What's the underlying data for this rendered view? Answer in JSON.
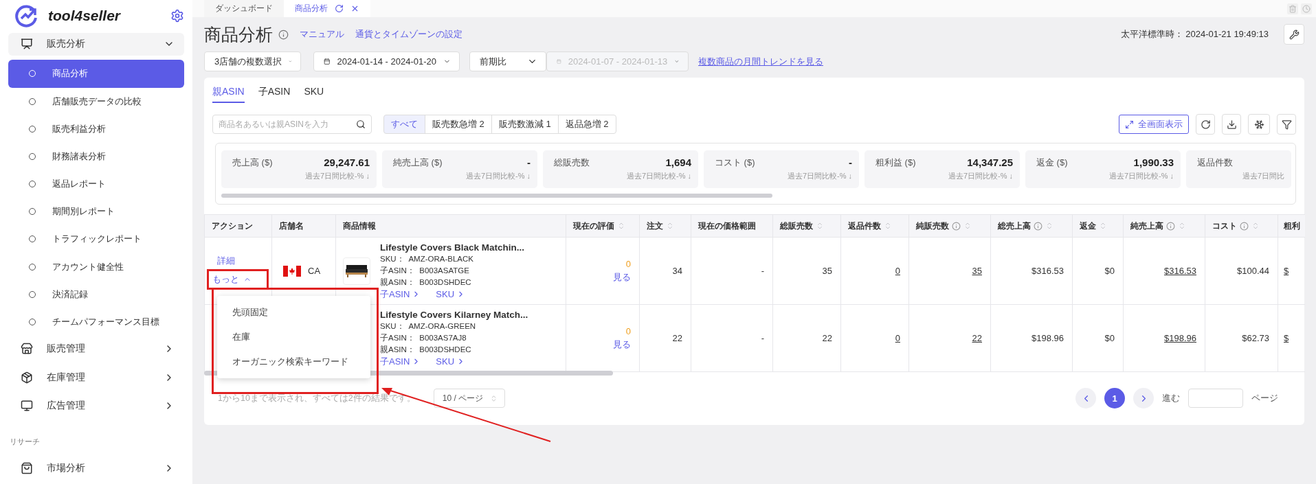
{
  "sidebar": {
    "brand": "tool4seller",
    "sections": [
      {
        "label": "販売分析",
        "expanded": true,
        "children": [
          {
            "label": "商品分析",
            "selected": true
          },
          {
            "label": "店舗販売データの比較",
            "selected": false
          },
          {
            "label": "販売利益分析",
            "selected": false
          },
          {
            "label": "財務諸表分析",
            "selected": false
          },
          {
            "label": "返品レポート",
            "selected": false
          },
          {
            "label": "期間別レポート",
            "selected": false
          },
          {
            "label": "トラフィックレポート",
            "selected": false
          },
          {
            "label": "アカウント健全性",
            "selected": false
          },
          {
            "label": "決済記録",
            "selected": false
          },
          {
            "label": "チームパフォーマンス目標",
            "selected": false
          }
        ]
      },
      {
        "label": "販売管理",
        "expanded": false
      },
      {
        "label": "在庫管理",
        "expanded": false
      },
      {
        "label": "広告管理",
        "expanded": false
      }
    ],
    "heading": "リサーチ",
    "research": [
      {
        "label": "市場分析",
        "expanded": false
      }
    ]
  },
  "page_tabs": [
    {
      "label": "ダッシュボード",
      "selected": false
    },
    {
      "label": "商品分析",
      "selected": true
    }
  ],
  "header": {
    "title": "商品分析",
    "links": [
      "マニュアル",
      "通貨とタイムゾーンの設定"
    ],
    "clock": "太平洋標準時： 2024-01-21 19:49:13"
  },
  "filters": {
    "store_select": "3店舗の複数選択",
    "date_range": "2024-01-14 - 2024-01-20",
    "compare_select": "前期比",
    "compare_range": {
      "value": "2024-01-07 - 2024-01-13",
      "disabled": true
    },
    "trend_link": "複数商品の月間トレンドを見る"
  },
  "view_tabs": [
    {
      "label": "親ASIN",
      "selected": true
    },
    {
      "label": "子ASIN",
      "selected": false
    },
    {
      "label": "SKU",
      "selected": false
    }
  ],
  "search": {
    "placeholder": "商品名あるいは親ASINを入力"
  },
  "segments": [
    {
      "label": "すべて",
      "selected": true
    },
    {
      "label": "販売数急増 2",
      "selected": false
    },
    {
      "label": "販売数激減 1",
      "selected": false
    },
    {
      "label": "返品急増 2",
      "selected": false
    }
  ],
  "fullscreen_button": "全画面表示",
  "metrics": [
    {
      "label": "売上高 ($)",
      "value": "29,247.61",
      "change": "過去7日間比較-% ↓"
    },
    {
      "label": "純売上高 ($)",
      "value": "-",
      "change": "過去7日間比較-% ↓"
    },
    {
      "label": "総販売数",
      "value": "1,694",
      "change": "過去7日間比較-% ↓"
    },
    {
      "label": "コスト ($)",
      "value": "-",
      "change": "過去7日間比較-% ↓"
    },
    {
      "label": "粗利益 ($)",
      "value": "14,347.25",
      "change": "過去7日間比較-% ↓"
    },
    {
      "label": "返金 ($)",
      "value": "1,990.33",
      "change": "過去7日間比較-% ↓"
    },
    {
      "label": "返品件数",
      "change": "過去7日間比"
    }
  ],
  "table": {
    "columns": [
      {
        "label": "アクション",
        "sortable": false,
        "info": false
      },
      {
        "label": "店舗名",
        "sortable": false,
        "info": false
      },
      {
        "label": "商品情報",
        "sortable": false,
        "info": false
      },
      {
        "label": "現在の評価",
        "sortable": true,
        "info": false
      },
      {
        "label": "注文",
        "sortable": true,
        "info": false
      },
      {
        "label": "現在の価格範囲",
        "sortable": false,
        "info": false
      },
      {
        "label": "総販売数",
        "sortable": true,
        "info": false
      },
      {
        "label": "返品件数",
        "sortable": true,
        "info": false
      },
      {
        "label": "純販売数",
        "sortable": true,
        "info": true
      },
      {
        "label": "総売上高",
        "sortable": true,
        "info": true
      },
      {
        "label": "返金",
        "sortable": true,
        "info": false
      },
      {
        "label": "純売上高",
        "sortable": true,
        "info": true
      },
      {
        "label": "コスト",
        "sortable": true,
        "info": true
      },
      {
        "label": "粗利"
      }
    ],
    "rows": [
      {
        "detail": "詳細",
        "more": "もっと",
        "country": "CA",
        "product": {
          "kind": "picture",
          "title": "Lifestyle Covers Black Matchin...",
          "meta": [
            "SKU：  AMZ-ORA-BLACK",
            "子ASIN：  B003ASATGE",
            "親ASIN：  B003DSHDEC"
          ],
          "links": [
            "子ASIN",
            "SKU"
          ]
        },
        "rating": {
          "value": "0",
          "link": "見る"
        },
        "values": [
          {
            "text": "34",
            "underline": false
          },
          {
            "text": "-",
            "underline": false
          },
          {
            "text": "35",
            "underline": false
          },
          {
            "text": "0",
            "underline": true
          },
          {
            "text": "35",
            "underline": true
          },
          {
            "text": "$316.53",
            "underline": false
          },
          {
            "text": "$0",
            "underline": false
          },
          {
            "text": "$316.53",
            "underline": true
          },
          {
            "text": "$100.44",
            "underline": false
          },
          {
            "text": "$",
            "underline": true
          }
        ]
      },
      {
        "product": {
          "title": "Lifestyle Covers Kilarney Match...",
          "meta": [
            "SKU：  AMZ-ORA-GREEN",
            "子ASIN：  B003AS7AJ8",
            "親ASIN：  B003DSHDEC"
          ],
          "links": [
            "子ASIN",
            "SKU"
          ]
        },
        "rating": {
          "value": "0",
          "link": "見る"
        },
        "values": [
          {
            "text": "22",
            "underline": false
          },
          {
            "text": "-",
            "underline": false
          },
          {
            "text": "22",
            "underline": false
          },
          {
            "text": "0",
            "underline": true
          },
          {
            "text": "22",
            "underline": true
          },
          {
            "text": "$198.96",
            "underline": false
          },
          {
            "text": "$0",
            "underline": false
          },
          {
            "text": "$198.96",
            "underline": true
          },
          {
            "text": "$62.73",
            "underline": false
          },
          {
            "text": "$",
            "underline": true
          }
        ]
      }
    ]
  },
  "more_menu": {
    "items": [
      "先頭固定",
      "在庫",
      "オーガニック検索キーワード"
    ]
  },
  "pagination": {
    "summary": "1から10まで表示され、すべては2件の結果です。",
    "page_size": "10 / ページ",
    "pages": [
      {
        "label": "1",
        "selected": true
      }
    ],
    "goto_label": "進む",
    "goto_suffix": "ページ"
  }
}
